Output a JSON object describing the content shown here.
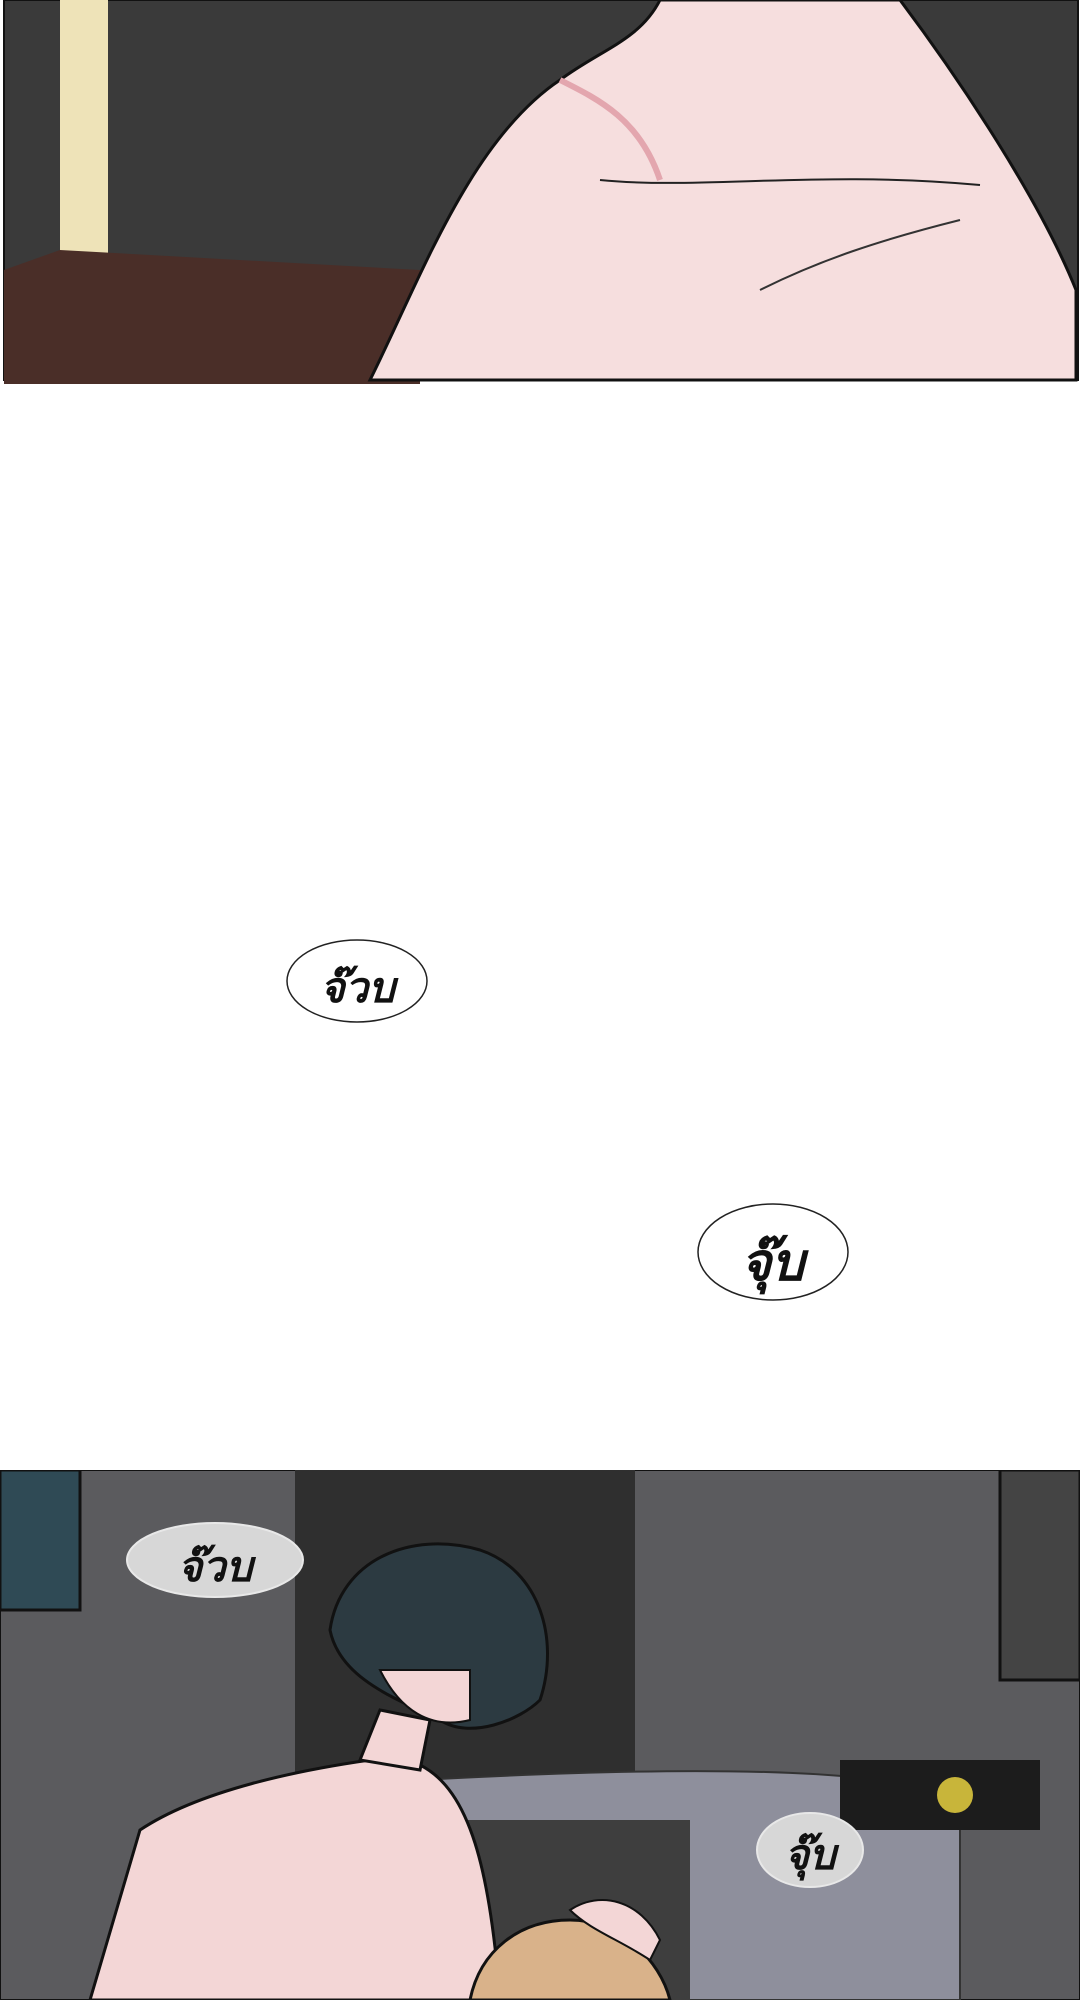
{
  "panels": [
    {
      "name": "top-panel",
      "description_free": true
    },
    {
      "name": "bottom-panel",
      "description_free": true
    }
  ],
  "sfx": {
    "kiss_1": "จ๊วบ",
    "kiss_2": "จุ๊บ",
    "kiss_3": "จ๊วบ",
    "kiss_4": "จุ๊บ"
  },
  "colors": {
    "skin": "#f6dede",
    "skin_shadow": "#e9b8bd",
    "room_dark": "#3b3b3b",
    "room_wall": "#5d5d5f",
    "hair": "#2c3a41",
    "blond_hair": "#d9b28a",
    "bubble_fill_light": "#ffffff",
    "bubble_fill_gray": "#d7d7d7"
  }
}
